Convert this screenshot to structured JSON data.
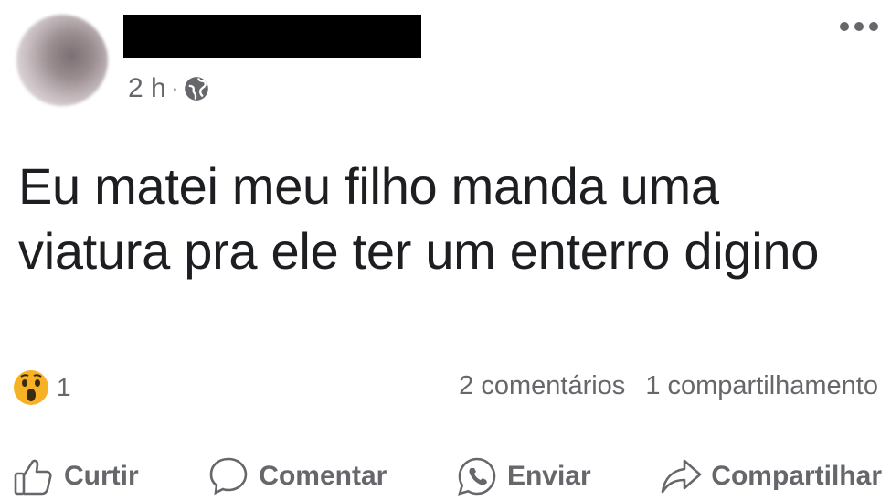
{
  "post": {
    "time": "2 h",
    "separator": "·",
    "text": "Eu matei meu filho manda uma viatura pra ele ter um enterro digino",
    "privacy_icon": "globe-icon",
    "more_icon": "more-options-icon"
  },
  "stats": {
    "reaction_icon": "wow-emoji-icon",
    "reaction_count": "1",
    "comments": "2 comentários",
    "shares": "1 compartilhamento"
  },
  "actions": {
    "like": "Curtir",
    "comment": "Comentar",
    "send": "Enviar",
    "share": "Compartilhar"
  },
  "colors": {
    "text": "#1c1e21",
    "secondary": "#65676b",
    "background": "#ffffff",
    "wow_face": "#f7b125"
  }
}
